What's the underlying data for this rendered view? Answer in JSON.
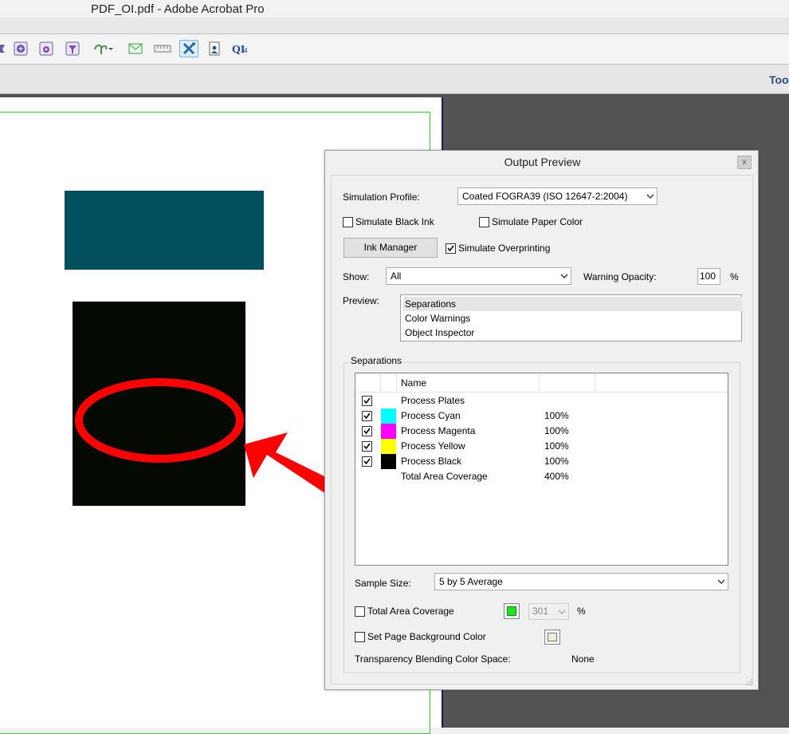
{
  "window": {
    "title": "PDF_OI.pdf - Adobe Acrobat Pro"
  },
  "toolbar": {
    "icons": [
      "stamp-tool-icon",
      "globe-icon",
      "gear-window-icon",
      "filter-icon",
      "plant-tool-icon",
      "envelope-icon",
      "ruler-icon",
      "edit-tools-icon",
      "document-person-icon",
      "qi-icon"
    ]
  },
  "navbar": {
    "tools_label": "Too"
  },
  "document": {
    "colors": {
      "teal": "#00505f",
      "black": "#040a02",
      "annotation": "#ff0000"
    }
  },
  "output_preview": {
    "title": "Output Preview",
    "close_glyph": "x",
    "simulation_profile": {
      "label": "Simulation Profile:",
      "value": "Coated FOGRA39 (ISO 12647-2:2004)"
    },
    "simulate_black_ink": {
      "label": "Simulate Black Ink",
      "checked": false
    },
    "simulate_paper_color": {
      "label": "Simulate Paper Color",
      "checked": false
    },
    "ink_manager_label": "Ink Manager",
    "simulate_overprinting": {
      "label": "Simulate Overprinting",
      "checked": true
    },
    "show": {
      "label": "Show:",
      "value": "All"
    },
    "warning_opacity": {
      "label": "Warning Opacity:",
      "value": "100",
      "unit": "%"
    },
    "preview": {
      "label": "Preview:",
      "options": [
        "Separations",
        "Color Warnings",
        "Object Inspector"
      ],
      "selected": "Separations"
    },
    "separations": {
      "legend": "Separations",
      "columns": [
        "",
        "",
        "Name",
        "",
        ""
      ],
      "rows": [
        {
          "checked": true,
          "swatch": "",
          "name": "Process Plates",
          "pct": ""
        },
        {
          "checked": true,
          "swatch": "#00ffff",
          "name": "Process Cyan",
          "pct": "100%"
        },
        {
          "checked": true,
          "swatch": "#ff00ff",
          "name": "Process Magenta",
          "pct": "100%"
        },
        {
          "checked": true,
          "swatch": "#ffff00",
          "name": "Process Yellow",
          "pct": "100%"
        },
        {
          "checked": true,
          "swatch": "#000000",
          "name": "Process Black",
          "pct": "100%"
        },
        {
          "checked": false,
          "swatch": "",
          "name": "Total Area Coverage",
          "pct": "400%"
        }
      ]
    },
    "sample_size": {
      "label": "Sample Size:",
      "value": "5 by 5 Average"
    },
    "total_area_coverage": {
      "label": "Total Area Coverage",
      "checked": false,
      "color": "#22dd22",
      "value": "301",
      "unit": "%"
    },
    "page_background": {
      "label": "Set Page Background Color",
      "checked": false,
      "color": "#eeeedd"
    },
    "blending": {
      "label": "Transparency Blending Color Space:",
      "value": "None"
    }
  }
}
